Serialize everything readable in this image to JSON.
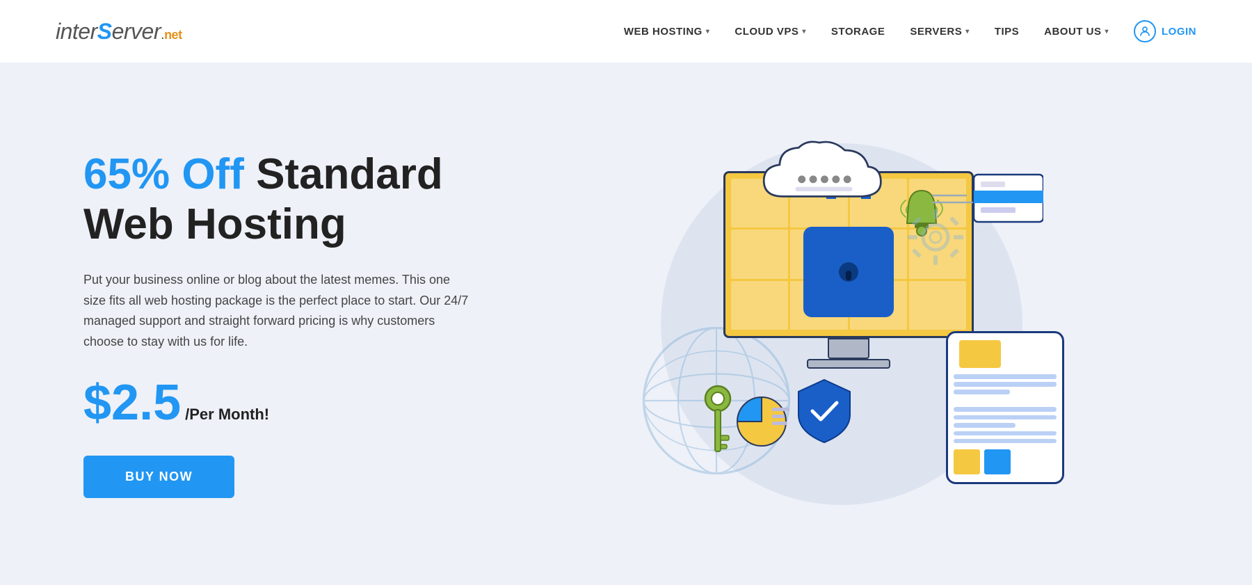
{
  "header": {
    "logo": {
      "prefix_inter": "inter",
      "letter_s": "S",
      "suffix_erver": "erver",
      "dot": ".",
      "net": "net"
    },
    "nav": [
      {
        "id": "web-hosting",
        "label": "WEB HOSTING",
        "hasDropdown": true
      },
      {
        "id": "cloud-vps",
        "label": "CLOUD VPS",
        "hasDropdown": true
      },
      {
        "id": "storage",
        "label": "STORAGE",
        "hasDropdown": false
      },
      {
        "id": "servers",
        "label": "SERVERS",
        "hasDropdown": true
      },
      {
        "id": "tips",
        "label": "TIPS",
        "hasDropdown": false
      },
      {
        "id": "about-us",
        "label": "ABOUT US",
        "hasDropdown": true
      }
    ],
    "login": {
      "label": "LOGIN"
    }
  },
  "hero": {
    "title_highlight": "65% Off",
    "title_rest": " Standard\nWeb Hosting",
    "description": "Put your business online or blog about the latest memes. This one size fits all web hosting package is the perfect place to start. Our 24/7 managed support and straight forward pricing is why customers choose to stay with us for life.",
    "price": "$2.5",
    "price_suffix": "/Per Month!",
    "cta_label": "BUY NOW"
  },
  "colors": {
    "accent_blue": "#2196f3",
    "dark_navy": "#1a3a7c",
    "gold_yellow": "#f5c842",
    "bg_light": "#eef1f8"
  }
}
